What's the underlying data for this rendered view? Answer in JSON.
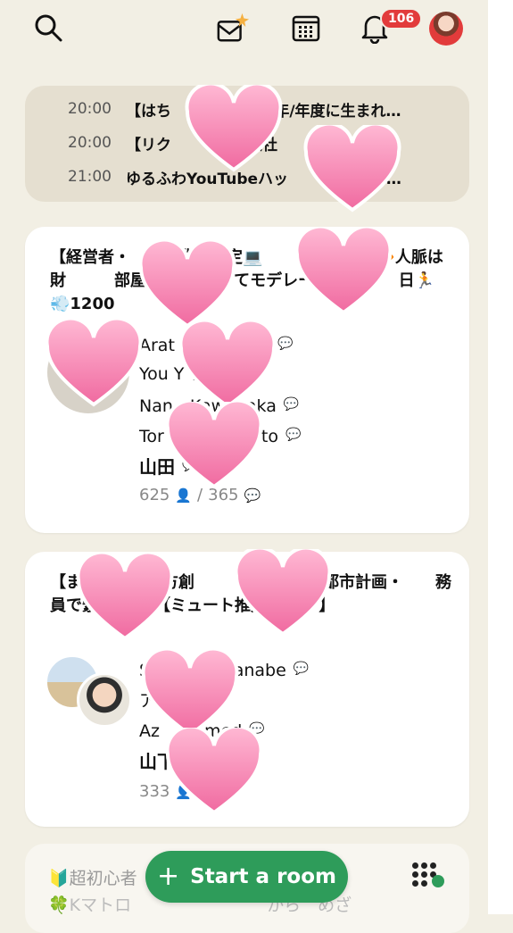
{
  "header": {
    "notifications_count": "106",
    "icons": [
      "search-icon",
      "invite-envelope-icon",
      "calendar-icon",
      "bell-icon",
      "profile-avatar"
    ]
  },
  "schedule": [
    {
      "time": "20:00",
      "title": "【はち　　　　1987年/年度に生まれ…"
    },
    {
      "time": "20:00",
      "title": "【リク　　　　年入社　　ラブハウ…"
    },
    {
      "time": "21:00",
      "title": "ゆるふわYouTubeハッ　　　　ー(ゲ…"
    }
  ],
  "rooms": [
    {
      "title": "【経営者・　　事業主限定💻　　　　ヤロバ🔶人脈は財　　　部屋INで👋　　てモデレーター🔝　　日🏃 💨1200",
      "speakers": [
        "Arat　　　　ura",
        "You Y",
        "Nan　Kawanaka",
        "Tor　　　sumoto",
        "山田"
      ],
      "listeners": "625",
      "chats": "365"
    },
    {
      "title": "【ま　　　・地方創　　　　　事業・都市計画・　　務員で繋が　　　【ミュート推奨、🔰　】",
      "speakers": [
        "S　　　Watanabe",
        "ア",
        "Az　　nmed",
        "山下"
      ],
      "listeners": "333",
      "chats": "1"
    }
  ],
  "bottom_card": {
    "line1": "🔰超初心者　　　　　　　　性が6日",
    "line2": "🍀Kマトロ　　　　　　　　から　めざ"
  },
  "start_button": {
    "label": "Start a room"
  },
  "colors": {
    "background": "#f2efe4",
    "accent": "#2e9c5a",
    "badge": "#e23b3b",
    "heart": "#f7a6c6"
  }
}
